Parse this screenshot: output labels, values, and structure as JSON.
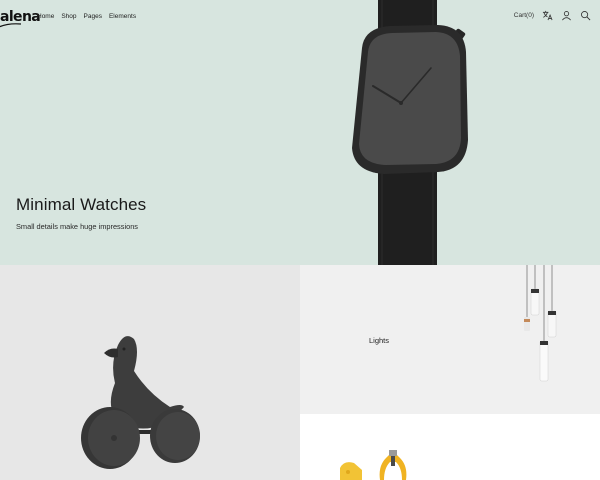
{
  "header": {
    "logo_text": "alena",
    "nav": [
      {
        "label": "Home"
      },
      {
        "label": "Shop"
      },
      {
        "label": "Pages"
      },
      {
        "label": "Elements"
      }
    ],
    "cart_label": "Cart(0)",
    "icons": [
      "translate-icon",
      "user-icon",
      "search-icon"
    ]
  },
  "hero": {
    "title": "Minimal Watches",
    "subtitle": "Small details make huge impressions",
    "background": "#d7e5df"
  },
  "tiles": {
    "duck": {
      "background": "#e7e7e7"
    },
    "lights": {
      "label": "Lights",
      "background": "#f0f0f0"
    },
    "kitchen": {
      "background": "#ffffff"
    }
  }
}
